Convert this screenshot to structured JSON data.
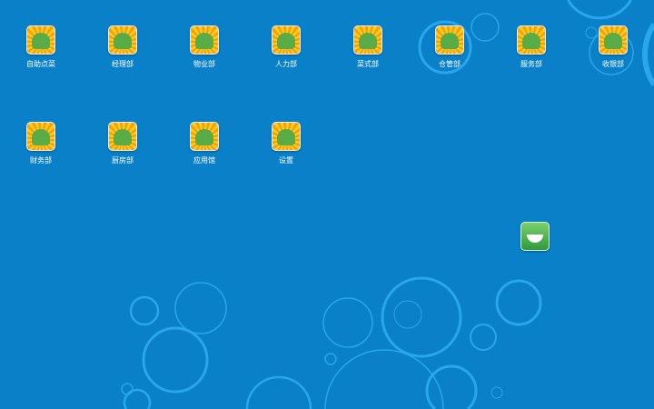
{
  "desktop": {
    "row1": [
      {
        "label": "自助点菜",
        "icon": "self-order-icon"
      },
      {
        "label": "经理部",
        "icon": "manager-icon"
      },
      {
        "label": "物业部",
        "icon": "property-icon"
      },
      {
        "label": "人力部",
        "icon": "hr-icon"
      },
      {
        "label": "菜式部",
        "icon": "dishes-icon"
      },
      {
        "label": "仓管部",
        "icon": "warehouse-icon"
      },
      {
        "label": "服务部",
        "icon": "service-icon"
      },
      {
        "label": "收银部",
        "icon": "cashier-icon"
      }
    ],
    "row2": [
      {
        "label": "财务部",
        "icon": "finance-icon"
      },
      {
        "label": "厨房部",
        "icon": "kitchen-icon"
      },
      {
        "label": "应用馆",
        "icon": "app-store-icon"
      },
      {
        "label": "设置",
        "icon": "settings-icon"
      }
    ]
  },
  "colors": {
    "background": "#0a80c8",
    "circle": "#2aa8f0"
  }
}
